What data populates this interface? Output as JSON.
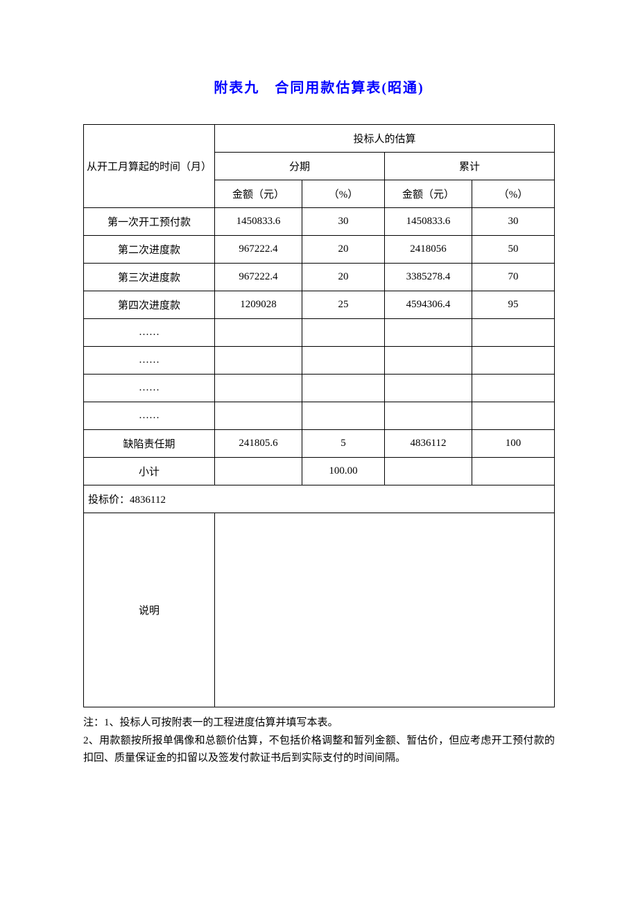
{
  "title": "附表九　合同用款估算表(昭通)",
  "headers": {
    "row_label": "从开工月算起的时间（月）",
    "estimate": "投标人的估算",
    "period": "分期",
    "cumulative": "累计",
    "amount": "金额（元）",
    "percent": "（%）"
  },
  "rows": [
    {
      "label": "第一次开工预付款",
      "p_amt": "1450833.6",
      "p_pct": "30",
      "c_amt": "1450833.6",
      "c_pct": "30"
    },
    {
      "label": "第二次进度款",
      "p_amt": "967222.4",
      "p_pct": "20",
      "c_amt": "2418056",
      "c_pct": "50"
    },
    {
      "label": "第三次进度款",
      "p_amt": "967222.4",
      "p_pct": "20",
      "c_amt": "3385278.4",
      "c_pct": "70"
    },
    {
      "label": "第四次进度款",
      "p_amt": "1209028",
      "p_pct": "25",
      "c_amt": "4594306.4",
      "c_pct": "95"
    },
    {
      "label": "……",
      "p_amt": "",
      "p_pct": "",
      "c_amt": "",
      "c_pct": ""
    },
    {
      "label": "……",
      "p_amt": "",
      "p_pct": "",
      "c_amt": "",
      "c_pct": ""
    },
    {
      "label": "……",
      "p_amt": "",
      "p_pct": "",
      "c_amt": "",
      "c_pct": ""
    },
    {
      "label": "……",
      "p_amt": "",
      "p_pct": "",
      "c_amt": "",
      "c_pct": ""
    },
    {
      "label": "缺陷责任期",
      "p_amt": "241805.6",
      "p_pct": "5",
      "c_amt": "4836112",
      "c_pct": "100"
    },
    {
      "label": "小计",
      "p_amt": "",
      "p_pct": "100.00",
      "c_amt": "",
      "c_pct": ""
    }
  ],
  "bid_price": "投标价：4836112",
  "description_label": "说明",
  "description_content": "",
  "notes": {
    "line1": "注：1、投标人可按附表一的工程进度估算并填写本表。",
    "line2": "2、用款额按所报单偶像和总额价估算，不包括价格调整和暂列金额、暂估价，但应考虑开工预付款的扣回、质量保证金的扣留以及签发付款证书后到实际支付的时间间隔。"
  },
  "chart_data": {
    "type": "table",
    "title": "合同用款估算表(昭通)",
    "columns": [
      "从开工月算起的时间（月）",
      "分期金额（元）",
      "分期（%）",
      "累计金额（元）",
      "累计（%）"
    ],
    "rows": [
      [
        "第一次开工预付款",
        1450833.6,
        30,
        1450833.6,
        30
      ],
      [
        "第二次进度款",
        967222.4,
        20,
        2418056,
        50
      ],
      [
        "第三次进度款",
        967222.4,
        20,
        3385278.4,
        70
      ],
      [
        "第四次进度款",
        1209028,
        25,
        4594306.4,
        95
      ],
      [
        "缺陷责任期",
        241805.6,
        5,
        4836112,
        100
      ],
      [
        "小计",
        null,
        100.0,
        null,
        null
      ]
    ],
    "bid_price": 4836112
  }
}
